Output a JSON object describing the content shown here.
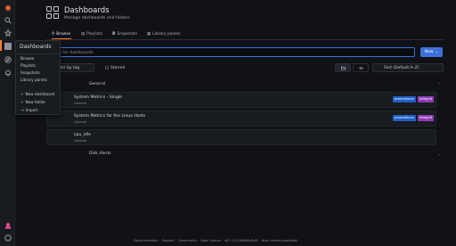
{
  "header": {
    "title": "Dashboards",
    "subtitle": "Manage dashboards and folders"
  },
  "tabs": [
    {
      "label": "Browse"
    },
    {
      "label": "Playlists"
    },
    {
      "label": "Snapshots"
    },
    {
      "label": "Library panels"
    }
  ],
  "flyout": {
    "title": "Dashboards",
    "items": [
      "Browse",
      "Playlists",
      "Snapshots",
      "Library panels"
    ],
    "actions": [
      "New dashboard",
      "New folder",
      "Import"
    ]
  },
  "search": {
    "placeholder": "h for dashboards"
  },
  "new_button": "New",
  "filters": {
    "tag": "ilter by tag",
    "starred": "Starred",
    "sort": "Sort (Default A–Z)"
  },
  "folders": [
    {
      "name": "General"
    },
    {
      "name": "Disk Alerts"
    }
  ],
  "dashboards": [
    {
      "name": "System Metrics - Single",
      "folder": "General",
      "tags": [
        "prometheus",
        "telegraf"
      ]
    },
    {
      "name": "System Metrics for the Linux Hosts",
      "folder": "General",
      "tags": [
        "prometheus",
        "telegraf"
      ]
    },
    {
      "name": "cpu_idle",
      "folder": "General",
      "tags": []
    }
  ],
  "colors": {
    "prometheus": "#1f60c4",
    "telegraf": "#8f3bb8",
    "accent": "#ff7f2a",
    "primary": "#3d71d9"
  },
  "footer": [
    "Documentation",
    "Support",
    "Community",
    "Open Source",
    "v8.1.4 (2166d0b6c4)",
    "New version available!"
  ]
}
